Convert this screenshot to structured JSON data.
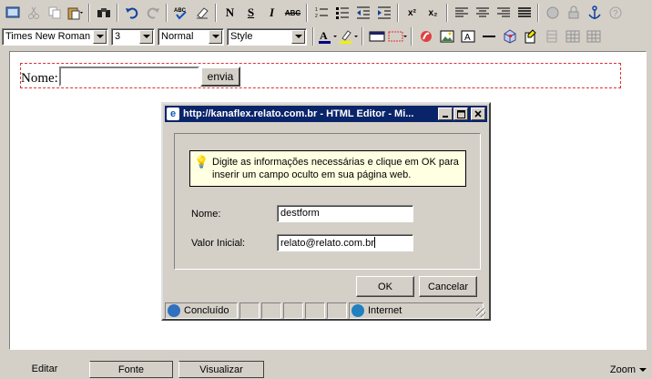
{
  "toolbar1": {
    "items": [
      "toggle-view-icon",
      "cut-icon",
      "copy-icon",
      "paste-icon",
      "find-icon",
      "undo-icon",
      "redo-icon",
      "spellcheck-icon",
      "eraser-icon"
    ],
    "bold": "N",
    "underline": "S",
    "italic": "I",
    "strike": "ABC",
    "superscript": "x²",
    "subscript": "x₂"
  },
  "toolbar2": {
    "font": "Times New Roman",
    "size": "3",
    "format": "Normal",
    "style": "Style"
  },
  "editor": {
    "form_label": "Nome:",
    "submit_label": "envia"
  },
  "dialog": {
    "title": "http://kanaflex.relato.com.br - HTML Editor - Mi...",
    "info": "Digite as informações necessárias e clique em OK para inserir um campo oculto em sua página web.",
    "name_label": "Nome:",
    "name_value": "destform",
    "initial_label": "Valor Inicial:",
    "initial_value": "relato@relato.com.br",
    "ok": "OK",
    "cancel": "Cancelar",
    "status": "Concluído",
    "zone": "Internet"
  },
  "tabs": {
    "edit": "Editar",
    "source": "Fonte",
    "preview": "Visualizar",
    "zoom": "Zoom"
  },
  "colors": {
    "titlebar": "#0a246a",
    "form_border": "#e03030",
    "info_bg": "#ffffe1"
  }
}
